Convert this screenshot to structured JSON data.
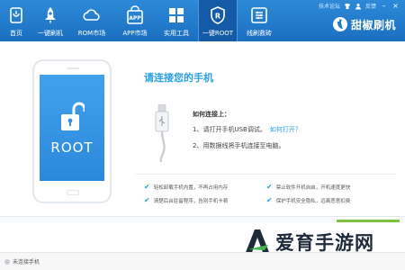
{
  "nav": [
    {
      "label": "首页",
      "icon": "home-icon"
    },
    {
      "label": "一键刷机",
      "icon": "rocket-icon"
    },
    {
      "label": "ROM市场",
      "icon": "cloud-icon"
    },
    {
      "label": "APP市场",
      "icon": "app-bag-icon"
    },
    {
      "label": "实用工具",
      "icon": "grid-icon"
    },
    {
      "label": "一键ROOT",
      "icon": "root-shield-icon",
      "active": true
    },
    {
      "label": "线刷救砖",
      "icon": "tools-icon"
    }
  ],
  "top_links": {
    "forum": "技术论坛",
    "feedback": "反馈"
  },
  "brand": {
    "name": "甜椒刷机"
  },
  "phone": {
    "screen_text": "ROOT"
  },
  "connect": {
    "title": "请连接您的手机",
    "howto_title": "如何连接上：",
    "step1": "1、请打开手机USB调试。",
    "step1_link": "如何打开？",
    "step2": "2、用数据线将手机连接至电脑。"
  },
  "features": [
    "轻松卸载手机内置，不再占用内存",
    "禁止软件开机自启，开机速度更快",
    "清楚后台驻留程序，告别手机卡顿",
    "保护手机安全隐私，远离恶意扣费"
  ],
  "status": {
    "text": "未连接手机"
  },
  "watermark": {
    "text": "爱育手游网"
  },
  "colors": {
    "topbar": "#1f78c8",
    "accent": "#2aa1e4",
    "phone_screen": "#3a97e8",
    "green": "#7dc242"
  }
}
